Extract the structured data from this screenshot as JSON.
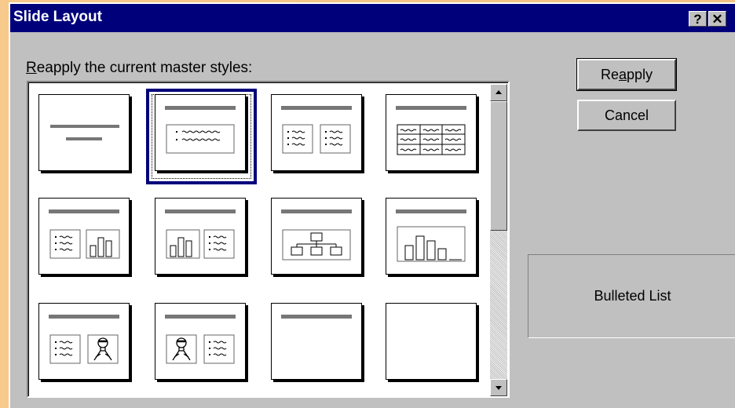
{
  "window": {
    "title": "Slide Layout",
    "help_button": "?",
    "close_button": "✕"
  },
  "label": {
    "pre": "",
    "mnemonic": "R",
    "rest": "eapply the current master styles:"
  },
  "buttons": {
    "reapply": {
      "pre": "Re",
      "mnemonic": "a",
      "post": "pply"
    },
    "cancel": "Cancel"
  },
  "layouts": [
    "title-slide",
    "bulleted-list",
    "two-column-text",
    "table",
    "text-and-chart",
    "chart-and-text",
    "organization-chart",
    "chart",
    "text-and-clip-art",
    "clip-art-and-text",
    "title-only",
    "blank"
  ],
  "selected_layout": "bulleted-list",
  "preview_label": "Bulleted List",
  "colors": {
    "title_bar": "#00007b",
    "dialog_face": "#c0c0c0",
    "selection": "#00007b"
  }
}
